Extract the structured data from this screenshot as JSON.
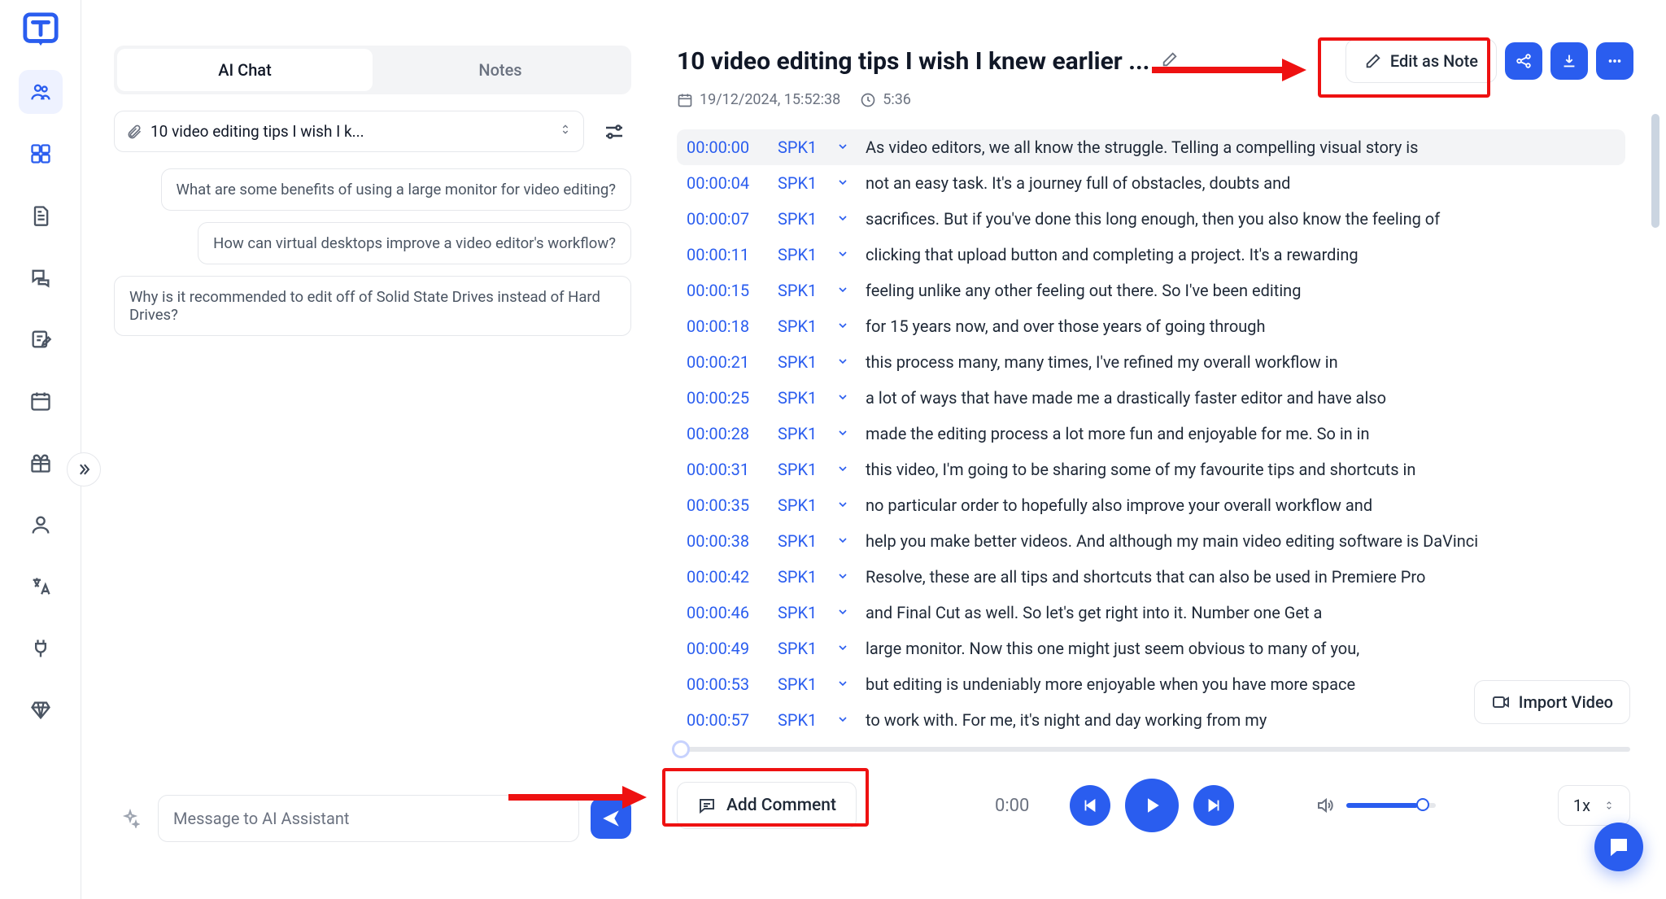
{
  "sidebar": {
    "icons": [
      "people",
      "grid",
      "doc",
      "chat",
      "edit-note",
      "calendar",
      "gift",
      "user",
      "language",
      "plug",
      "diamond"
    ]
  },
  "tabs": {
    "ai_chat": "AI Chat",
    "notes": "Notes"
  },
  "file_chip": {
    "label": "10 video editing tips I wish I k..."
  },
  "suggestions": [
    "What are some benefits of using a large monitor for video editing?",
    "How can virtual desktops improve a video editor's workflow?",
    "Why is it recommended to edit off of Solid State Drives instead of Hard Drives?"
  ],
  "chat_input_placeholder": "Message to AI Assistant",
  "title": "10 video editing tips I wish I knew earlier ...",
  "meta": {
    "datetime": "19/12/2024, 15:52:38",
    "duration": "5:36"
  },
  "edit_as_note": "Edit as Note",
  "import_video": "Import Video",
  "add_comment": "Add Comment",
  "time_display": "0:00",
  "speed": "1x",
  "transcript": [
    {
      "t": "00:00:00",
      "s": "SPK1",
      "x": "As video editors, we all know the struggle. Telling a compelling visual story is"
    },
    {
      "t": "00:00:04",
      "s": "SPK1",
      "x": "not an easy task. It's a journey full of obstacles, doubts and"
    },
    {
      "t": "00:00:07",
      "s": "SPK1",
      "x": "sacrifices. But if you've done this long enough, then you also know the feeling of"
    },
    {
      "t": "00:00:11",
      "s": "SPK1",
      "x": "clicking that upload button and completing a project. It's a rewarding"
    },
    {
      "t": "00:00:15",
      "s": "SPK1",
      "x": "feeling unlike any other feeling out there. So I've been editing"
    },
    {
      "t": "00:00:18",
      "s": "SPK1",
      "x": "for 15 years now, and over those years of going through"
    },
    {
      "t": "00:00:21",
      "s": "SPK1",
      "x": "this process many, many times, I've refined my overall workflow in"
    },
    {
      "t": "00:00:25",
      "s": "SPK1",
      "x": "a lot of ways that have made me a drastically faster editor and have also"
    },
    {
      "t": "00:00:28",
      "s": "SPK1",
      "x": "made the editing process a lot more fun and enjoyable for me. So in in"
    },
    {
      "t": "00:00:31",
      "s": "SPK1",
      "x": "this video, I'm going to be sharing some of my favourite tips and shortcuts in"
    },
    {
      "t": "00:00:35",
      "s": "SPK1",
      "x": "no particular order to hopefully also improve your overall workflow and"
    },
    {
      "t": "00:00:38",
      "s": "SPK1",
      "x": "help you make better videos. And although my main video editing software is DaVinci"
    },
    {
      "t": "00:00:42",
      "s": "SPK1",
      "x": "Resolve, these are all tips and shortcuts that can also be used in Premiere Pro"
    },
    {
      "t": "00:00:46",
      "s": "SPK1",
      "x": "and Final Cut as well. So let's get right into it. Number one Get a"
    },
    {
      "t": "00:00:49",
      "s": "SPK1",
      "x": "large monitor. Now this one might just seem obvious to many of you,"
    },
    {
      "t": "00:00:53",
      "s": "SPK1",
      "x": "but editing is undeniably more enjoyable when you have more space"
    },
    {
      "t": "00:00:57",
      "s": "SPK1",
      "x": "to work with. For me, it's night and day working from my"
    }
  ]
}
